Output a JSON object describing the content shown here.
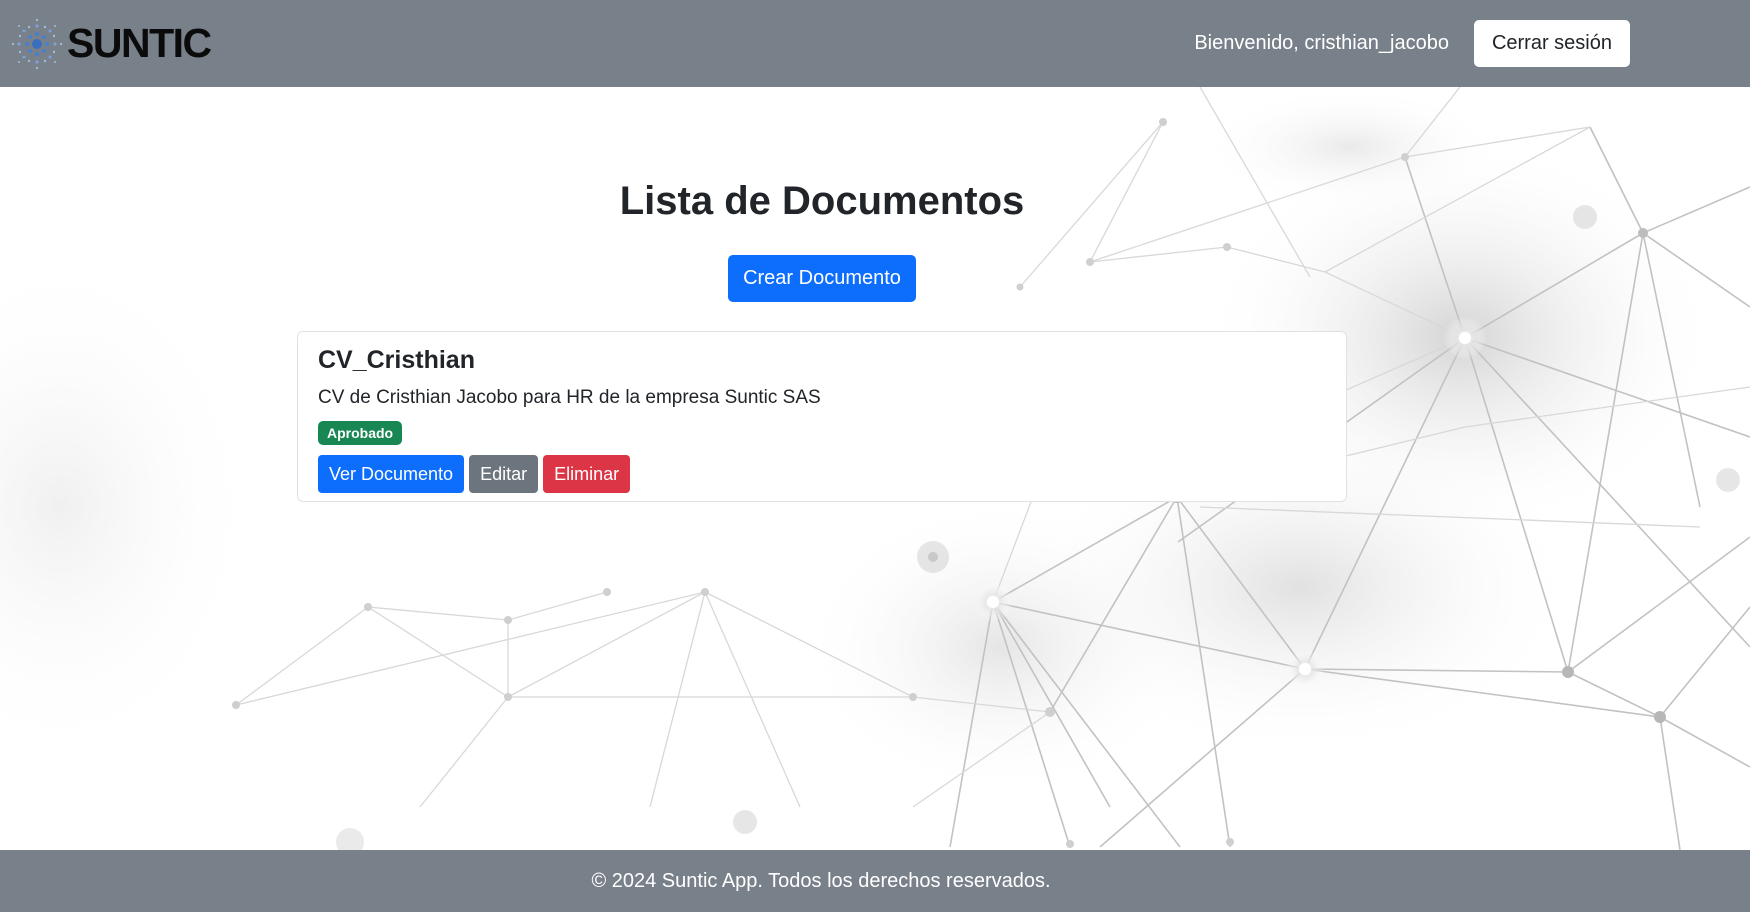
{
  "header": {
    "brand_name": "SUNTIC",
    "logo_icon": "suntic-logo-icon",
    "welcome_text": "Bienvenido, cristhian_jacobo",
    "logout_label": "Cerrar sesión"
  },
  "main": {
    "title": "Lista de Documentos",
    "create_label": "Crear Documento",
    "documents": [
      {
        "title": "CV_Cristhian",
        "description": "CV de Cristhian Jacobo para HR de la empresa Suntic SAS",
        "status": "Aprobado",
        "view_label": "Ver Documento",
        "edit_label": "Editar",
        "delete_label": "Eliminar"
      }
    ]
  },
  "footer": {
    "text": "© 2024 Suntic App. Todos los derechos reservados."
  },
  "colors": {
    "navbar": "#78808a",
    "primary": "#0d6efd",
    "secondary": "#6c757d",
    "danger": "#dc3545",
    "success": "#198754"
  }
}
